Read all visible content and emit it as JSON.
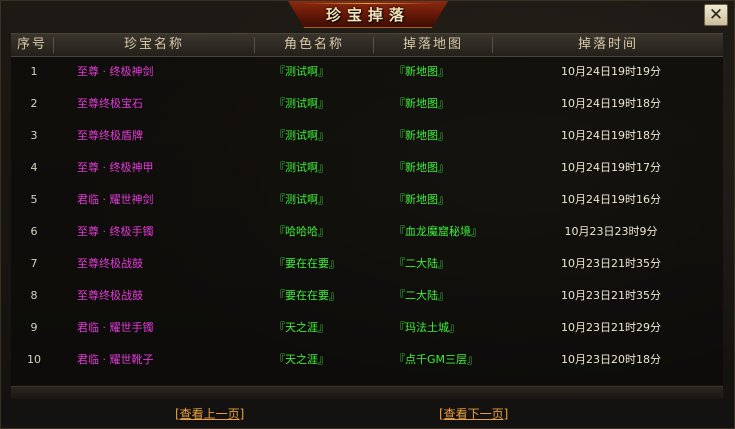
{
  "window": {
    "title": "珍宝掉落",
    "close_label": "✕"
  },
  "table": {
    "headers": [
      "序号",
      "珍宝名称",
      "角色名称",
      "掉落地图",
      "掉落时间"
    ],
    "rows": [
      {
        "index": "1",
        "item": "至尊 · 终极神剑",
        "role": "『测试啊』",
        "map": "『新地图』",
        "time": "10月24日19时19分"
      },
      {
        "index": "2",
        "item": "至尊终极宝石",
        "role": "『测试啊』",
        "map": "『新地图』",
        "time": "10月24日19时18分"
      },
      {
        "index": "3",
        "item": "至尊终极盾牌",
        "role": "『测试啊』",
        "map": "『新地图』",
        "time": "10月24日19时18分"
      },
      {
        "index": "4",
        "item": "至尊 · 终极神甲",
        "role": "『测试啊』",
        "map": "『新地图』",
        "time": "10月24日19时17分"
      },
      {
        "index": "5",
        "item": "君临 · 耀世神剑",
        "role": "『测试啊』",
        "map": "『新地图』",
        "time": "10月24日19时16分"
      },
      {
        "index": "6",
        "item": "至尊 · 终极手镯",
        "role": "『哈哈哈』",
        "map": "『血龙魔窟秘境』",
        "time": "10月23日23时9分"
      },
      {
        "index": "7",
        "item": "至尊终极战鼓",
        "role": "『要在在要』",
        "map": "『二大陆』",
        "time": "10月23日21时35分"
      },
      {
        "index": "8",
        "item": "至尊终极战鼓",
        "role": "『要在在要』",
        "map": "『二大陆』",
        "time": "10月23日21时35分"
      },
      {
        "index": "9",
        "item": "君临 · 耀世手镯",
        "role": "『天之涯』",
        "map": "『玛法土城』",
        "time": "10月23日21时29分"
      },
      {
        "index": "10",
        "item": "君临 · 耀世靴子",
        "role": "『天之涯』",
        "map": "『点千GM三层』",
        "time": "10月23日20时18分"
      }
    ]
  },
  "pager": {
    "prev_label": "[查看上一页]",
    "next_label": "[查看下一页]"
  },
  "colors": {
    "item_name": "#e23ad6",
    "role_map": "#3df03a",
    "link": "#e8a040"
  }
}
